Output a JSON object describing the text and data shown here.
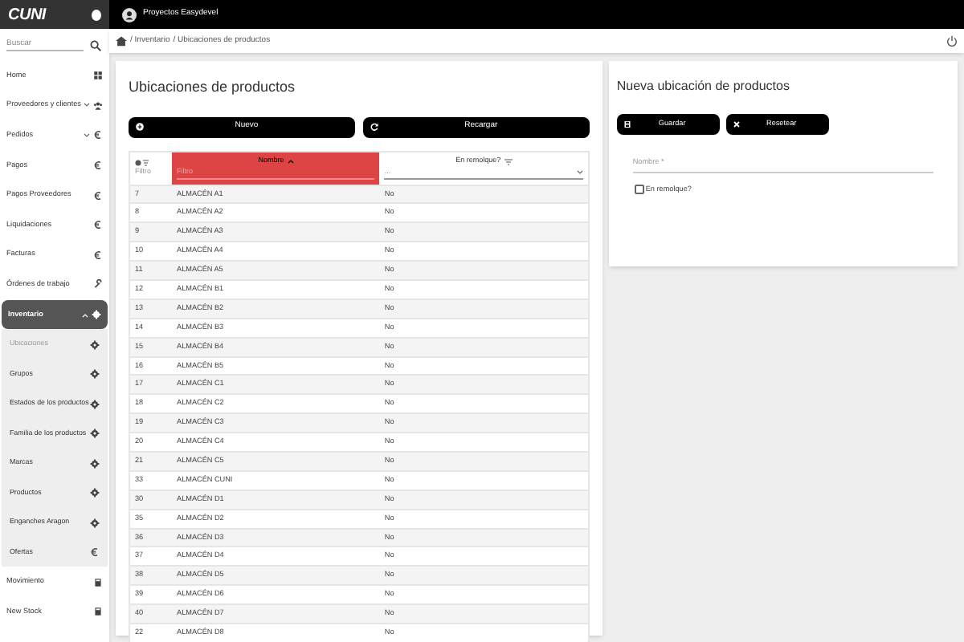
{
  "logo": "CUNI",
  "topbar": {
    "title": "Proyectos Easydevel"
  },
  "breadcrumb": [
    "/ Inventario",
    "/ Ubicaciones de productos"
  ],
  "sidebar": {
    "search": {
      "placeholder": "Buscar"
    },
    "items": [
      {
        "label": "Home",
        "selected": false
      },
      {
        "label": "Proveedores y clientes",
        "expanded": false,
        "selected": false
      },
      {
        "label": "Pedidos",
        "expanded": false,
        "selected": false
      },
      {
        "label": "Pagos",
        "selected": false
      },
      {
        "label": "Pagos Proveedores",
        "selected": false
      },
      {
        "label": "Liquidaciones",
        "selected": false
      },
      {
        "label": "Facturas",
        "selected": false
      },
      {
        "label": "Órdenes de trabajo",
        "selected": false
      },
      {
        "label": "Inventario",
        "expanded": true,
        "selected": true,
        "children": [
          {
            "label": "Ubicaciones",
            "selected": true
          },
          {
            "label": "Grupos",
            "selected": false
          },
          {
            "label": "Estados de los productos",
            "selected": false
          },
          {
            "label": "Familia de los productos",
            "selected": false
          },
          {
            "label": "Marcas",
            "selected": false
          },
          {
            "label": "Productos",
            "selected": false
          },
          {
            "label": "Enganches Aragon",
            "selected": false
          },
          {
            "label": "Ofertas",
            "selected": false
          }
        ]
      },
      {
        "label": "Movimiento",
        "selected": false
      },
      {
        "label": "New Stock",
        "selected": false
      }
    ]
  },
  "list_panel": {
    "title": "Ubicaciones de productos",
    "buttons": [
      "Nuevo",
      "Recargar"
    ],
    "table": {
      "columns": [
        {
          "kind": "filter",
          "label": "Filtro"
        },
        {
          "kind": "text",
          "label": "Nombre",
          "sorted": true,
          "placeholder": "Filtro"
        },
        {
          "kind": "select",
          "label": "En remolque?",
          "sorted": false,
          "placeholder": "..."
        }
      ],
      "rows": [
        [
          "7",
          "ALMACÉN A1",
          "No"
        ],
        [
          "8",
          "ALMACÉN A2",
          "No"
        ],
        [
          "9",
          "ALMACÉN A3",
          "No"
        ],
        [
          "10",
          "ALMACÉN A4",
          "No"
        ],
        [
          "11",
          "ALMACÉN A5",
          "No"
        ],
        [
          "12",
          "ALMACÉN B1",
          "No"
        ],
        [
          "13",
          "ALMACÉN B2",
          "No"
        ],
        [
          "14",
          "ALMACÉN B3",
          "No"
        ],
        [
          "15",
          "ALMACÉN B4",
          "No"
        ],
        [
          "16",
          "ALMACÉN B5",
          "No"
        ],
        [
          "17",
          "ALMACÉN C1",
          "No"
        ],
        [
          "18",
          "ALMACÉN C2",
          "No"
        ],
        [
          "19",
          "ALMACÉN C3",
          "No"
        ],
        [
          "20",
          "ALMACÉN C4",
          "No"
        ],
        [
          "21",
          "ALMACÉN C5",
          "No"
        ],
        [
          "33",
          "ALMACÉN CUNI",
          "No"
        ],
        [
          "30",
          "ALMACÉN D1",
          "No"
        ],
        [
          "35",
          "ALMACÉN D2",
          "No"
        ],
        [
          "36",
          "ALMACÉN D3",
          "No"
        ],
        [
          "37",
          "ALMACÉN D4",
          "No"
        ],
        [
          "38",
          "ALMACÉN D5",
          "No"
        ],
        [
          "39",
          "ALMACÉN D6",
          "No"
        ],
        [
          "40",
          "ALMACÉN D7",
          "No"
        ],
        [
          "22",
          "ALMACÉN D8",
          "No"
        ]
      ]
    }
  },
  "form_panel": {
    "title": "Nueva ubicación de productos",
    "buttons": [
      "Guardar",
      "Resetear"
    ],
    "name_field": {
      "placeholder": "Nombre *"
    },
    "checkbox": {
      "label": "En remolque?",
      "checked": false
    }
  }
}
